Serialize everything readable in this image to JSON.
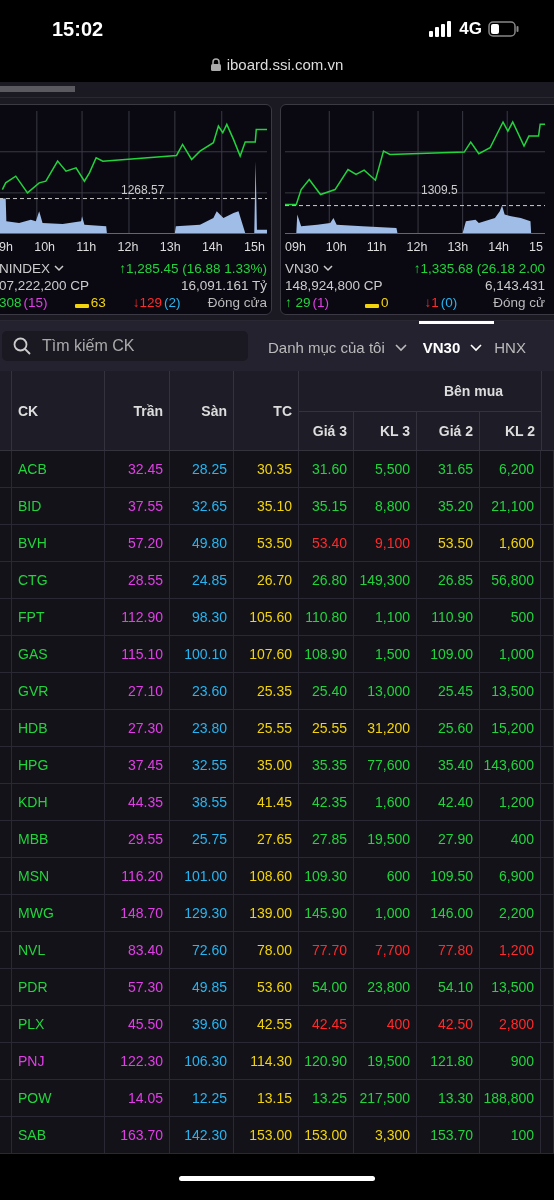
{
  "status_bar": {
    "time": "15:02",
    "network": "4G"
  },
  "address_bar": {
    "url": "iboard.ssi.com.vn"
  },
  "index_cards": [
    {
      "reference": "1268.57",
      "x_labels": [
        "9h",
        "10h",
        "11h",
        "12h",
        "13h",
        "14h",
        "15h"
      ],
      "name": "NINDEX",
      "change": "↑1,285.45 (16.88 1.33%)",
      "volume": "07,222,200 CP",
      "value": "16,091.161 Tỷ",
      "advances": "308",
      "advances_ceiling": "(15)",
      "unchanged": "63",
      "declines": "↓129",
      "declines_floor": "(2)",
      "status": "Đóng cửa"
    },
    {
      "reference": "1309.5",
      "x_labels": [
        "09h",
        "10h",
        "11h",
        "12h",
        "13h",
        "14h",
        "15"
      ],
      "name": "VN30",
      "change": "↑1,335.68 (26.18 2.00",
      "volume": "148,924,800 CP",
      "value": "6,143.431",
      "advances": "↑ 29",
      "advances_ceiling": "(1)",
      "unchanged": "0",
      "declines": "↓1",
      "declines_floor": "(0)",
      "status": "Đóng cử"
    }
  ],
  "search": {
    "placeholder": "Tìm kiếm CK"
  },
  "tabs": [
    {
      "label": "Danh mục của tôi",
      "selected": false,
      "dropdown": true
    },
    {
      "label": "VN30",
      "selected": true,
      "dropdown": true
    },
    {
      "label": "HNX",
      "selected": false,
      "dropdown": false
    }
  ],
  "table": {
    "columns": [
      "CK",
      "Trần",
      "Sàn",
      "TC"
    ],
    "group": "Bên mua",
    "sub_columns": [
      "Giá 3",
      "KL 3",
      "Giá 2",
      "KL 2"
    ],
    "rows": [
      {
        "symbol": "ACB",
        "color": "#22d43c",
        "ceiling": "32.45",
        "floor": "28.25",
        "ref": "30.35",
        "bids": [
          {
            "price": "31.60",
            "volume": "5,500",
            "color": "#22d43c"
          },
          {
            "price": "31.65",
            "volume": "6,200",
            "color": "#22d43c"
          }
        ]
      },
      {
        "symbol": "BID",
        "color": "#22d43c",
        "ceiling": "37.55",
        "floor": "32.65",
        "ref": "35.10",
        "bids": [
          {
            "price": "35.15",
            "volume": "8,800",
            "color": "#22d43c"
          },
          {
            "price": "35.20",
            "volume": "21,100",
            "color": "#22d43c"
          }
        ]
      },
      {
        "symbol": "BVH",
        "color": "#22d43c",
        "ceiling": "57.20",
        "floor": "49.80",
        "ref": "53.50",
        "bids": [
          {
            "price": "53.40",
            "volume": "9,100",
            "color": "#ff2a2a"
          },
          {
            "price": "53.50",
            "volume": "1,600",
            "color": "#f2d40c"
          }
        ]
      },
      {
        "symbol": "CTG",
        "color": "#22d43c",
        "ceiling": "28.55",
        "floor": "24.85",
        "ref": "26.70",
        "bids": [
          {
            "price": "26.80",
            "volume": "149,300",
            "color": "#22d43c"
          },
          {
            "price": "26.85",
            "volume": "56,800",
            "color": "#22d43c"
          }
        ]
      },
      {
        "symbol": "FPT",
        "color": "#22d43c",
        "ceiling": "112.90",
        "floor": "98.30",
        "ref": "105.60",
        "bids": [
          {
            "price": "110.80",
            "volume": "1,100",
            "color": "#22d43c"
          },
          {
            "price": "110.90",
            "volume": "500",
            "color": "#22d43c"
          }
        ]
      },
      {
        "symbol": "GAS",
        "color": "#22d43c",
        "ceiling": "115.10",
        "floor": "100.10",
        "ref": "107.60",
        "bids": [
          {
            "price": "108.90",
            "volume": "1,500",
            "color": "#22d43c"
          },
          {
            "price": "109.00",
            "volume": "1,000",
            "color": "#22d43c"
          }
        ]
      },
      {
        "symbol": "GVR",
        "color": "#22d43c",
        "ceiling": "27.10",
        "floor": "23.60",
        "ref": "25.35",
        "bids": [
          {
            "price": "25.40",
            "volume": "13,000",
            "color": "#22d43c"
          },
          {
            "price": "25.45",
            "volume": "13,500",
            "color": "#22d43c"
          }
        ]
      },
      {
        "symbol": "HDB",
        "color": "#22d43c",
        "ceiling": "27.30",
        "floor": "23.80",
        "ref": "25.55",
        "bids": [
          {
            "price": "25.55",
            "volume": "31,200",
            "color": "#f2d40c"
          },
          {
            "price": "25.60",
            "volume": "15,200",
            "color": "#22d43c"
          }
        ]
      },
      {
        "symbol": "HPG",
        "color": "#22d43c",
        "ceiling": "37.45",
        "floor": "32.55",
        "ref": "35.00",
        "bids": [
          {
            "price": "35.35",
            "volume": "77,600",
            "color": "#22d43c"
          },
          {
            "price": "35.40",
            "volume": "143,600",
            "color": "#22d43c"
          }
        ]
      },
      {
        "symbol": "KDH",
        "color": "#22d43c",
        "ceiling": "44.35",
        "floor": "38.55",
        "ref": "41.45",
        "bids": [
          {
            "price": "42.35",
            "volume": "1,600",
            "color": "#22d43c"
          },
          {
            "price": "42.40",
            "volume": "1,200",
            "color": "#22d43c"
          }
        ]
      },
      {
        "symbol": "MBB",
        "color": "#22d43c",
        "ceiling": "29.55",
        "floor": "25.75",
        "ref": "27.65",
        "bids": [
          {
            "price": "27.85",
            "volume": "19,500",
            "color": "#22d43c"
          },
          {
            "price": "27.90",
            "volume": "400",
            "color": "#22d43c"
          }
        ]
      },
      {
        "symbol": "MSN",
        "color": "#22d43c",
        "ceiling": "116.20",
        "floor": "101.00",
        "ref": "108.60",
        "bids": [
          {
            "price": "109.30",
            "volume": "600",
            "color": "#22d43c"
          },
          {
            "price": "109.50",
            "volume": "6,900",
            "color": "#22d43c"
          }
        ]
      },
      {
        "symbol": "MWG",
        "color": "#22d43c",
        "ceiling": "148.70",
        "floor": "129.30",
        "ref": "139.00",
        "bids": [
          {
            "price": "145.90",
            "volume": "1,000",
            "color": "#22d43c"
          },
          {
            "price": "146.00",
            "volume": "2,200",
            "color": "#22d43c"
          }
        ]
      },
      {
        "symbol": "NVL",
        "color": "#22d43c",
        "ceiling": "83.40",
        "floor": "72.60",
        "ref": "78.00",
        "bids": [
          {
            "price": "77.70",
            "volume": "7,700",
            "color": "#ff2a2a"
          },
          {
            "price": "77.80",
            "volume": "1,200",
            "color": "#ff2a2a"
          }
        ]
      },
      {
        "symbol": "PDR",
        "color": "#22d43c",
        "ceiling": "57.30",
        "floor": "49.85",
        "ref": "53.60",
        "bids": [
          {
            "price": "54.00",
            "volume": "23,800",
            "color": "#22d43c"
          },
          {
            "price": "54.10",
            "volume": "13,500",
            "color": "#22d43c"
          }
        ]
      },
      {
        "symbol": "PLX",
        "color": "#22d43c",
        "ceiling": "45.50",
        "floor": "39.60",
        "ref": "42.55",
        "bids": [
          {
            "price": "42.45",
            "volume": "400",
            "color": "#ff2a2a"
          },
          {
            "price": "42.50",
            "volume": "2,800",
            "color": "#ff2a2a"
          }
        ]
      },
      {
        "symbol": "PNJ",
        "color": "#e23ee8",
        "ceiling": "122.30",
        "floor": "106.30",
        "ref": "114.30",
        "bids": [
          {
            "price": "120.90",
            "volume": "19,500",
            "color": "#22d43c"
          },
          {
            "price": "121.80",
            "volume": "900",
            "color": "#22d43c"
          }
        ]
      },
      {
        "symbol": "POW",
        "color": "#22d43c",
        "ceiling": "14.05",
        "floor": "12.25",
        "ref": "13.15",
        "bids": [
          {
            "price": "13.25",
            "volume": "217,500",
            "color": "#22d43c"
          },
          {
            "price": "13.30",
            "volume": "188,800",
            "color": "#22d43c"
          }
        ]
      },
      {
        "symbol": "SAB",
        "color": "#22d43c",
        "ceiling": "163.70",
        "floor": "142.30",
        "ref": "153.00",
        "bids": [
          {
            "price": "153.00",
            "volume": "3,300",
            "color": "#f2d40c"
          },
          {
            "price": "153.70",
            "volume": "100",
            "color": "#22d43c"
          }
        ]
      }
    ]
  }
}
